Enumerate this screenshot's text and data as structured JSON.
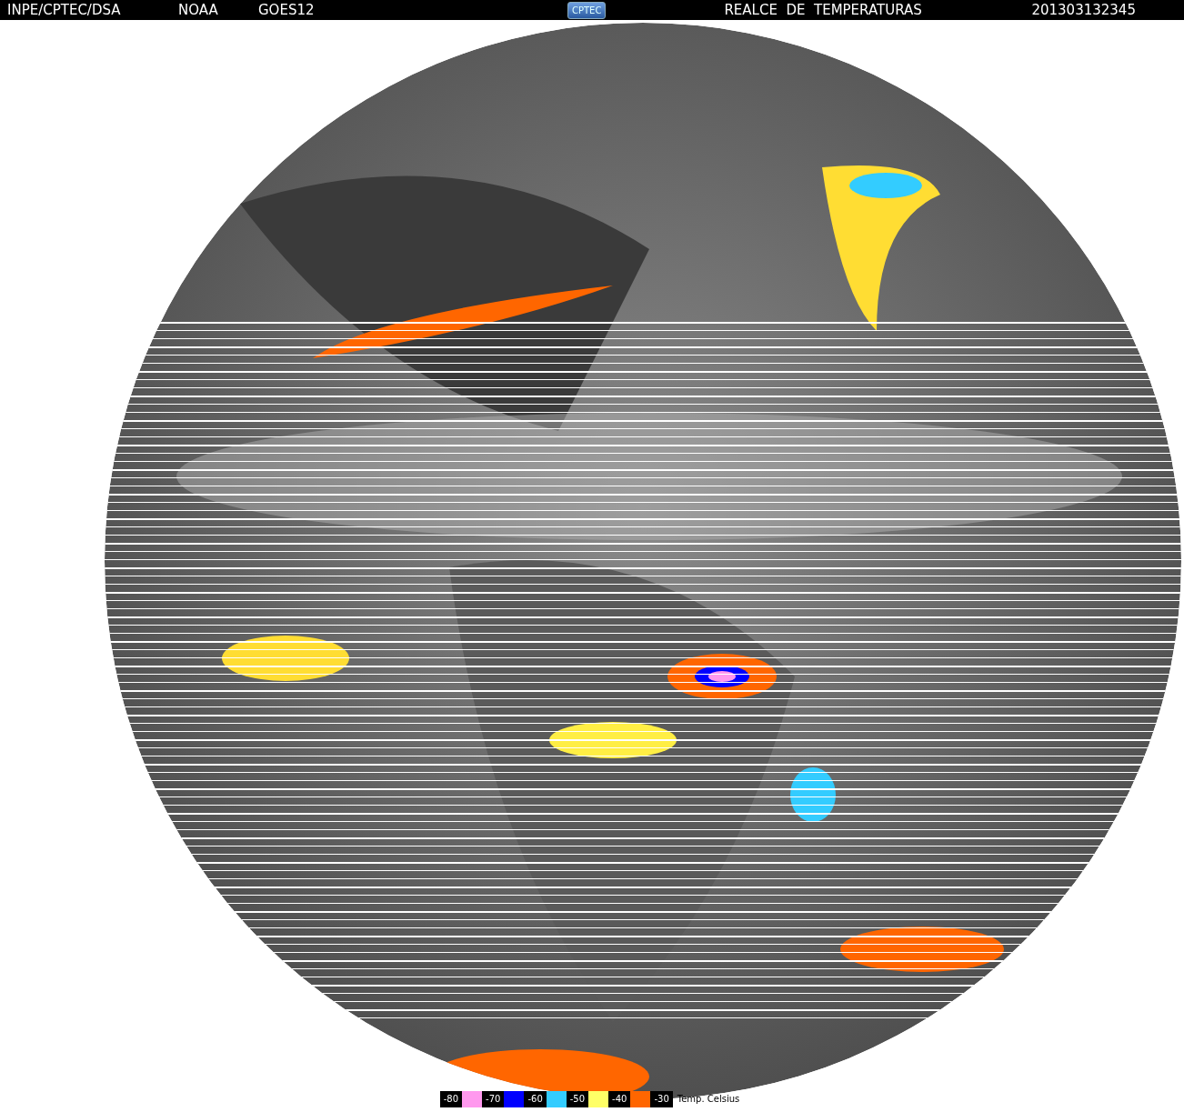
{
  "header": {
    "agency": "INPE/CPTEC/DSA",
    "operator": "NOAA",
    "satellite": "GOES12",
    "logo": "CPTEC",
    "product": "REALCE  DE  TEMPERATURAS",
    "timestamp": "201303132345"
  },
  "legend": {
    "items": [
      {
        "kind": "value",
        "label": "-80"
      },
      {
        "kind": "swatch",
        "color": "#ff99ee"
      },
      {
        "kind": "value",
        "label": "-70"
      },
      {
        "kind": "swatch",
        "color": "#0000ff"
      },
      {
        "kind": "value",
        "label": "-60"
      },
      {
        "kind": "swatch",
        "color": "#33ccff"
      },
      {
        "kind": "value",
        "label": "-50"
      },
      {
        "kind": "swatch",
        "color": "#ffff66"
      },
      {
        "kind": "value",
        "label": "-40"
      },
      {
        "kind": "swatch",
        "color": "#ff6600"
      },
      {
        "kind": "value",
        "label": "-30"
      }
    ],
    "unit": "Temp. Celsius"
  }
}
